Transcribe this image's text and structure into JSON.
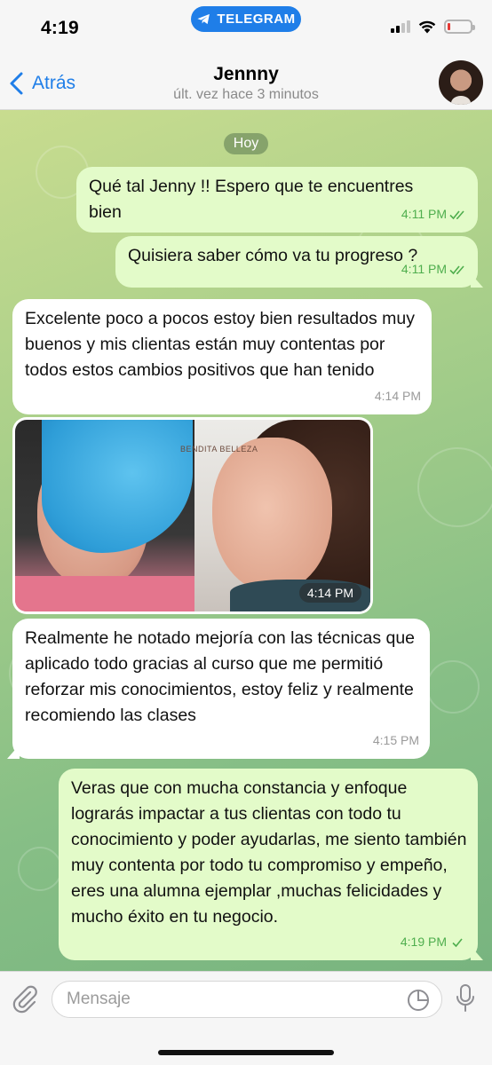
{
  "status_bar": {
    "time": "4:19",
    "app_pill": "TELEGRAM"
  },
  "header": {
    "back_label": "Atrás",
    "contact_name": "Jennny",
    "last_seen": "últ. vez hace 3 minutos"
  },
  "chat": {
    "date_separator": "Hoy",
    "messages": [
      {
        "direction": "out",
        "text": "Qué tal Jenny !! Espero que te encuentres bien",
        "time": "4:11 PM",
        "read": true
      },
      {
        "direction": "out",
        "text": "Quisiera saber cómo va tu progreso ?",
        "time": "4:11 PM",
        "read": true
      },
      {
        "direction": "in",
        "text": "Excelente poco a pocos estoy bien resultados muy buenos y mis clientas están muy contentas por todos estos cambios positivos que han tenido",
        "time": "4:14 PM"
      },
      {
        "direction": "in",
        "type": "photo",
        "watermark": "BENDITA BELLEZA",
        "time": "4:14 PM"
      },
      {
        "direction": "in",
        "text": "Realmente he notado mejoría con las técnicas que aplicado todo gracias al curso que me permitió reforzar mis conocimientos, estoy feliz y realmente recomiendo las clases",
        "time": "4:15 PM"
      },
      {
        "direction": "out",
        "text": "Veras que con mucha constancia y enfoque lograrás impactar a tus clientas con todo tu conocimiento y poder ayudarlas, me siento también muy contenta por todo tu compromiso y empeño, eres una alumna ejemplar ,muchas felicidades y mucho éxito en tu negocio.",
        "time": "4:19 PM",
        "read": false
      }
    ]
  },
  "input": {
    "placeholder": "Mensaje"
  },
  "colors": {
    "accent": "#1f7ee8",
    "outgoing_bubble": "#e3fbc9",
    "incoming_bubble": "#ffffff",
    "read_tick": "#4fae4e"
  }
}
